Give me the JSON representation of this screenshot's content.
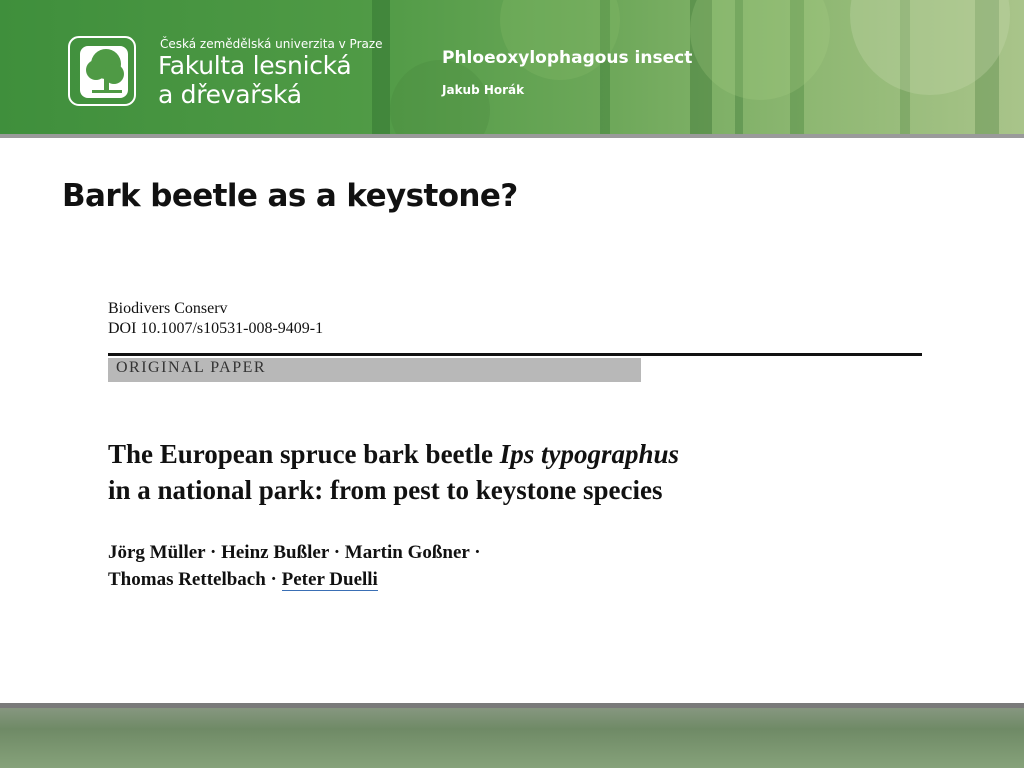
{
  "header": {
    "university_line": "Česká zemědělská univerzita v Praze",
    "faculty_line1": "Fakulta lesnická",
    "faculty_line2": "a dřevařská",
    "course_title": "Phloeoxylophagous insect",
    "author": "Jakub Horák",
    "logo_icon": "tree-logo-icon"
  },
  "slide": {
    "title": "Bark beetle as a keystone?"
  },
  "paper": {
    "journal": "Biodivers Conserv",
    "doi": "DOI 10.1007/s10531-008-9409-1",
    "section": "ORIGINAL PAPER",
    "title_part1": "The European spruce bark beetle ",
    "title_species": "Ips typographus",
    "title_line2": "in a national park: from pest to keystone species",
    "authors_line1": "Jörg Müller · Heinz Bußler · Martin Goßner ·",
    "authors_line2_prefix": "Thomas Rettelbach · ",
    "authors_linked": "Peter Duelli"
  },
  "colors": {
    "header_green": "#4f9a45",
    "link_underline": "#3a6fb5",
    "section_band": "#b8b8b8"
  }
}
